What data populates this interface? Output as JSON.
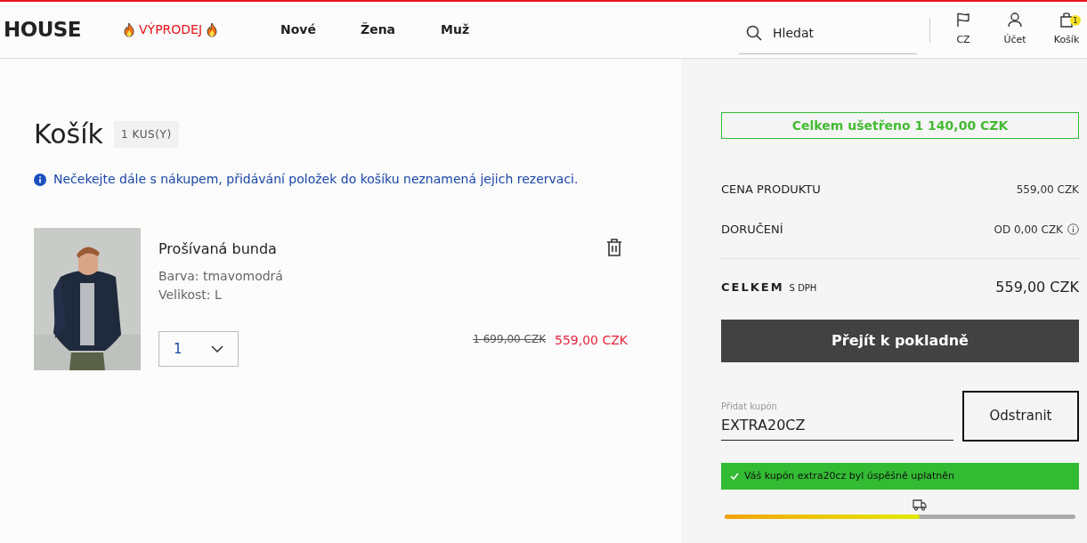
{
  "header": {
    "logo": "HOUSE",
    "nav": [
      {
        "label": "VÝPRODEJ",
        "kind": "sale"
      },
      {
        "label": "Nové",
        "kind": "plain"
      },
      {
        "label": "Žena",
        "kind": "plain"
      },
      {
        "label": "Muž",
        "kind": "plain"
      }
    ],
    "search": {
      "placeholder": "Hledat"
    },
    "actions": [
      {
        "label": "CZ",
        "kind": "flag"
      },
      {
        "label": "Účet",
        "kind": "user"
      },
      {
        "label": "Košík",
        "kind": "bag",
        "badge": "1"
      }
    ]
  },
  "cart": {
    "title": "Košík",
    "count": "1 KUS(Y)",
    "notice": "Nečekejte dále s nákupem, přidávání položek do košíku neznamená jejich rezervaci.",
    "items": [
      {
        "name": "Prošívaná bunda",
        "variant": "Barva: tmavomodrá",
        "size": "Velikost: L",
        "quantity": "1",
        "old_price": "1 699,00 CZK",
        "price": "559,00 CZK"
      }
    ]
  },
  "summary": {
    "saved": "Celkem ušetřeno 1 140,00 CZK",
    "rows": [
      {
        "label": "CENA PRODUKTU",
        "value": "559,00 CZK",
        "kind": "plain"
      },
      {
        "label": "DORUČENÍ",
        "value": "OD 0,00 CZK",
        "kind": "info"
      }
    ],
    "total_label": "CELKEM",
    "total_note": "S DPH",
    "total": "559,00 CZK",
    "checkout": "Přejít k pokladně",
    "coupon": {
      "label": "Přidat kupón",
      "value": "EXTRA20CZ",
      "button": "Odstranit"
    },
    "coupon_message": "Váš kupón extra20cz byl úspěšně uplatněn",
    "shipping_progress": {
      "level": 0.555
    }
  }
}
